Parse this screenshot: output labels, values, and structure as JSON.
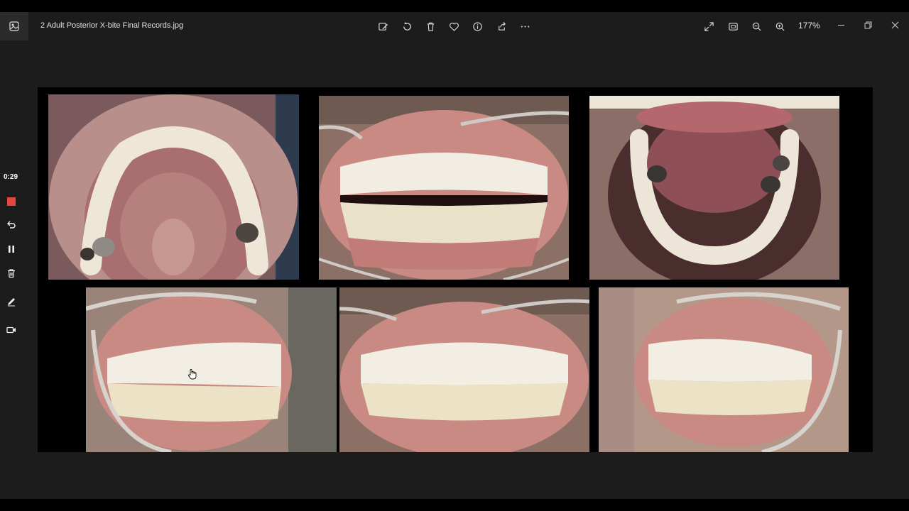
{
  "window": {
    "title": "2 Adult Posterior X-bite Final Records.jpg",
    "zoom": "177%"
  },
  "toolbar": {
    "icons": [
      "edit-image-icon",
      "rotate-icon",
      "delete-icon",
      "favorite-icon",
      "info-icon",
      "share-icon",
      "more-icon"
    ]
  },
  "view_controls": {
    "icons": [
      "fullscreen-icon",
      "fit-to-window-icon",
      "zoom-out-icon",
      "zoom-in-icon"
    ]
  },
  "recorder": {
    "elapsed": "0:29",
    "icons": [
      "stop-icon",
      "undo-icon",
      "pause-icon",
      "trash-icon",
      "pen-icon",
      "camera-icon"
    ]
  },
  "colors": {
    "window_bg": "#1c1c1c",
    "stop_red": "#e8453c",
    "gum": "#c98a84",
    "cheek": "#b89b8e",
    "tooth": "#f2ede2"
  },
  "photos": [
    {
      "view": "upper-occlusal"
    },
    {
      "view": "frontal-open"
    },
    {
      "view": "lower-occlusal"
    },
    {
      "view": "right-buccal"
    },
    {
      "view": "frontal-closed"
    },
    {
      "view": "left-buccal"
    }
  ]
}
